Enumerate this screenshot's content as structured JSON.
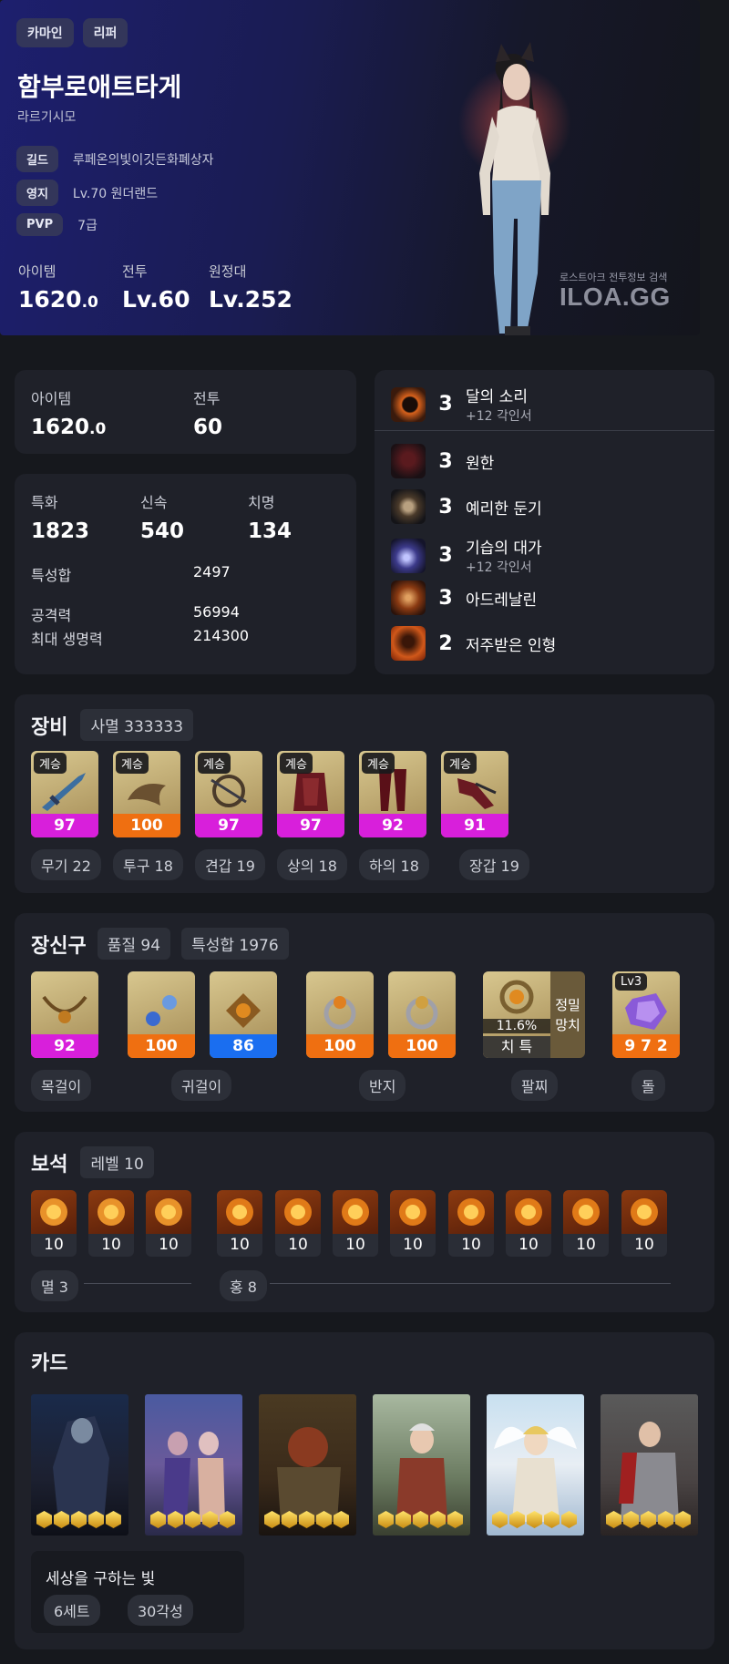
{
  "hero": {
    "tags": [
      "카마인",
      "리퍼"
    ],
    "name": "함부로애트타게",
    "server": "라르기시모",
    "guild_label": "길드",
    "guild_value": "루페온의빛이깃든화폐상자",
    "estate_label": "영지",
    "estate_value": "Lv.70 원더랜드",
    "pvp_label": "PVP",
    "pvp_value": "7급",
    "item_label": "아이템",
    "item_int": "1620",
    "item_dec": ".0",
    "combat_label": "전투",
    "combat_value": "Lv.60",
    "expedition_label": "원정대",
    "expedition_value": "Lv.252",
    "watermark_small": "로스트아크 전투정보 검색",
    "watermark_logo": "ILOA.GG"
  },
  "level_box": {
    "item_label": "아이템",
    "item_int": "1620",
    "item_dec": ".0",
    "combat_label": "전투",
    "combat_value": "60"
  },
  "stats": {
    "crit_spec_label": "특화",
    "crit_spec_value": "1823",
    "swift_label": "신속",
    "swift_value": "540",
    "crit_label": "치명",
    "crit_value": "134",
    "total_label": "특성합",
    "total_value": "2497",
    "atk_label": "공격력",
    "atk_value": "56994",
    "hp_label": "최대 생명력",
    "hp_value": "214300"
  },
  "engravings": [
    {
      "level": "3",
      "name": "달의 소리",
      "sub": "+12 각인서",
      "color": "#c8501a"
    },
    {
      "level": "3",
      "name": "원한",
      "sub": "",
      "color": "#7a1f24"
    },
    {
      "level": "3",
      "name": "예리한 둔기",
      "sub": "",
      "color": "#6b5a3a"
    },
    {
      "level": "3",
      "name": "기습의 대가",
      "sub": "+12 각인서",
      "color": "#3b3a7a"
    },
    {
      "level": "3",
      "name": "아드레날린",
      "sub": "",
      "color": "#8a3a12"
    },
    {
      "level": "2",
      "name": "저주받은 인형",
      "sub": "",
      "color": "#9a3a10"
    }
  ],
  "equipment": {
    "title": "장비",
    "set_chip": "사멸 333333",
    "items": [
      {
        "badge": "계승",
        "quality": "97",
        "label": "무기 22",
        "color": "pink",
        "icon": "sword-icon"
      },
      {
        "badge": "계승",
        "quality": "100",
        "label": "투구 18",
        "color": "orange",
        "icon": "helmet-icon"
      },
      {
        "badge": "계승",
        "quality": "97",
        "label": "견갑 19",
        "color": "pink",
        "icon": "shoulder-icon"
      },
      {
        "badge": "계승",
        "quality": "97",
        "label": "상의 18",
        "color": "pink",
        "icon": "chest-armor-icon"
      },
      {
        "badge": "계승",
        "quality": "92",
        "label": "하의 18",
        "color": "pink",
        "icon": "pants-icon"
      },
      {
        "badge": "계승",
        "quality": "91",
        "label": "장갑 19",
        "color": "pink",
        "icon": "gloves-icon"
      }
    ]
  },
  "accessories": {
    "title": "장신구",
    "quality_chip": "품질 94",
    "total_chip": "특성합 1976",
    "items": [
      {
        "quality": "92",
        "color": "pink"
      },
      {
        "quality": "100",
        "color": "orange"
      },
      {
        "quality": "86",
        "color": "blue"
      },
      {
        "quality": "100",
        "color": "orange"
      },
      {
        "quality": "100",
        "color": "orange"
      }
    ],
    "bracelet_pct": "11.6%",
    "bracelet_stat": "치 특",
    "bracelet_side1": "정밀",
    "bracelet_side2": "망치",
    "stone_lv": "Lv3",
    "stone_value": "9 7 2",
    "labels": [
      "목걸이",
      "귀걸이",
      "반지",
      "팔찌",
      "돌"
    ]
  },
  "gems": {
    "title": "보석",
    "level_chip": "레벨 10",
    "group1_label": "멸 3",
    "group2_label": "홍 8",
    "values": [
      "10",
      "10",
      "10",
      "10",
      "10",
      "10",
      "10",
      "10",
      "10",
      "10",
      "10"
    ]
  },
  "cards": {
    "title": "카드",
    "set_name": "세상을 구하는 빛",
    "set_chip": "6세트",
    "awake_chip": "30각성"
  }
}
